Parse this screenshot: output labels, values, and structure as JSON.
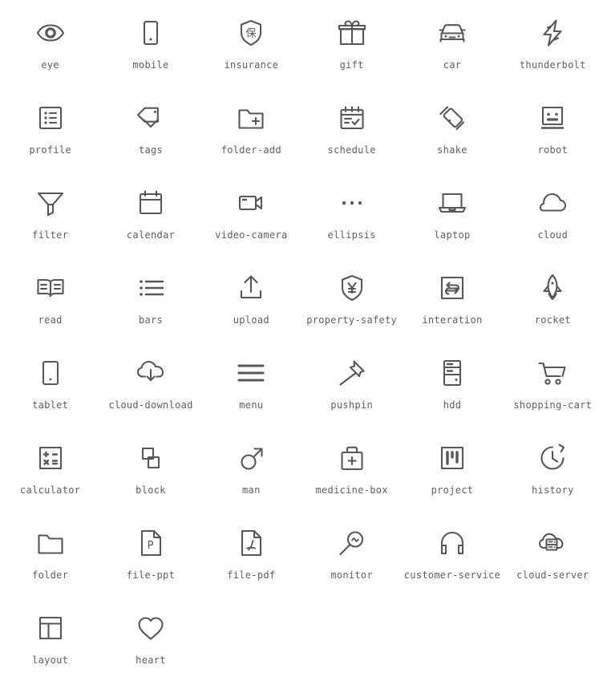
{
  "page": {
    "background_color": "#ffffff",
    "icon_color": "#555759",
    "label_color": "#5e6163",
    "columns": 6,
    "total_icons": 44
  },
  "icons": [
    {
      "name": "eye",
      "label": "eye"
    },
    {
      "name": "mobile",
      "label": "mobile"
    },
    {
      "name": "insurance",
      "label": "insurance"
    },
    {
      "name": "gift",
      "label": "gift"
    },
    {
      "name": "car",
      "label": "car"
    },
    {
      "name": "thunderbolt",
      "label": "thunderbolt"
    },
    {
      "name": "profile",
      "label": "profile"
    },
    {
      "name": "tags",
      "label": "tags"
    },
    {
      "name": "folder-add",
      "label": "folder-add"
    },
    {
      "name": "schedule",
      "label": "schedule"
    },
    {
      "name": "shake",
      "label": "shake"
    },
    {
      "name": "robot",
      "label": "robot"
    },
    {
      "name": "filter",
      "label": "filter"
    },
    {
      "name": "calendar",
      "label": "calendar"
    },
    {
      "name": "video-camera",
      "label": "video-camera"
    },
    {
      "name": "ellipsis",
      "label": "ellipsis"
    },
    {
      "name": "laptop",
      "label": "laptop"
    },
    {
      "name": "cloud",
      "label": "cloud"
    },
    {
      "name": "read",
      "label": "read"
    },
    {
      "name": "bars",
      "label": "bars"
    },
    {
      "name": "upload",
      "label": "upload"
    },
    {
      "name": "property-safety",
      "label": "property-safety"
    },
    {
      "name": "interation",
      "label": "interation"
    },
    {
      "name": "rocket",
      "label": "rocket"
    },
    {
      "name": "tablet",
      "label": "tablet"
    },
    {
      "name": "cloud-download",
      "label": "cloud-download"
    },
    {
      "name": "menu",
      "label": "menu"
    },
    {
      "name": "pushpin",
      "label": "pushpin"
    },
    {
      "name": "hdd",
      "label": "hdd"
    },
    {
      "name": "shopping-cart",
      "label": "shopping-cart"
    },
    {
      "name": "calculator",
      "label": "calculator"
    },
    {
      "name": "block",
      "label": "block"
    },
    {
      "name": "man",
      "label": "man"
    },
    {
      "name": "medicine-box",
      "label": "medicine-box"
    },
    {
      "name": "project",
      "label": "project"
    },
    {
      "name": "history",
      "label": "history"
    },
    {
      "name": "folder",
      "label": "folder"
    },
    {
      "name": "file-ppt",
      "label": "file-ppt"
    },
    {
      "name": "file-pdf",
      "label": "file-pdf"
    },
    {
      "name": "monitor",
      "label": "monitor"
    },
    {
      "name": "customer-service",
      "label": "customer-service"
    },
    {
      "name": "cloud-server",
      "label": "cloud-server"
    },
    {
      "name": "layout",
      "label": "layout"
    },
    {
      "name": "heart",
      "label": "heart"
    }
  ],
  "glyph_text": {
    "insurance": "保",
    "property-safety": "¥",
    "file-ppt": "P",
    "file-pdf": "A"
  }
}
